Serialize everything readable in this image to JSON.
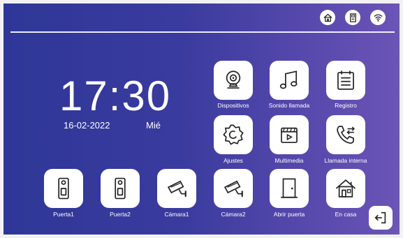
{
  "status_bar": {
    "icons": [
      "home-status-icon",
      "sd-card-icon",
      "wifi-icon"
    ]
  },
  "clock": {
    "time": "17:30",
    "date": "16-02-2022",
    "weekday": "Mié"
  },
  "apps": {
    "dispositivos": "Dispositivos",
    "sonido_llamada": "Sonido llamada",
    "registro": "Registro",
    "ajustes": "Ajustes",
    "multimedia": "Multimedia",
    "llamada_interna": "Llamada interna",
    "puerta1": "Puerta1",
    "puerta2": "Puerta2",
    "camara1": "Cámara1",
    "camara2": "Cámara2",
    "abrir_puerta": "Abrir puerta",
    "en_casa": "En casa"
  },
  "colors": {
    "background_start": "#2e3797",
    "background_end": "#6b55b6",
    "tile": "#ffffff",
    "text": "#ffffff"
  }
}
